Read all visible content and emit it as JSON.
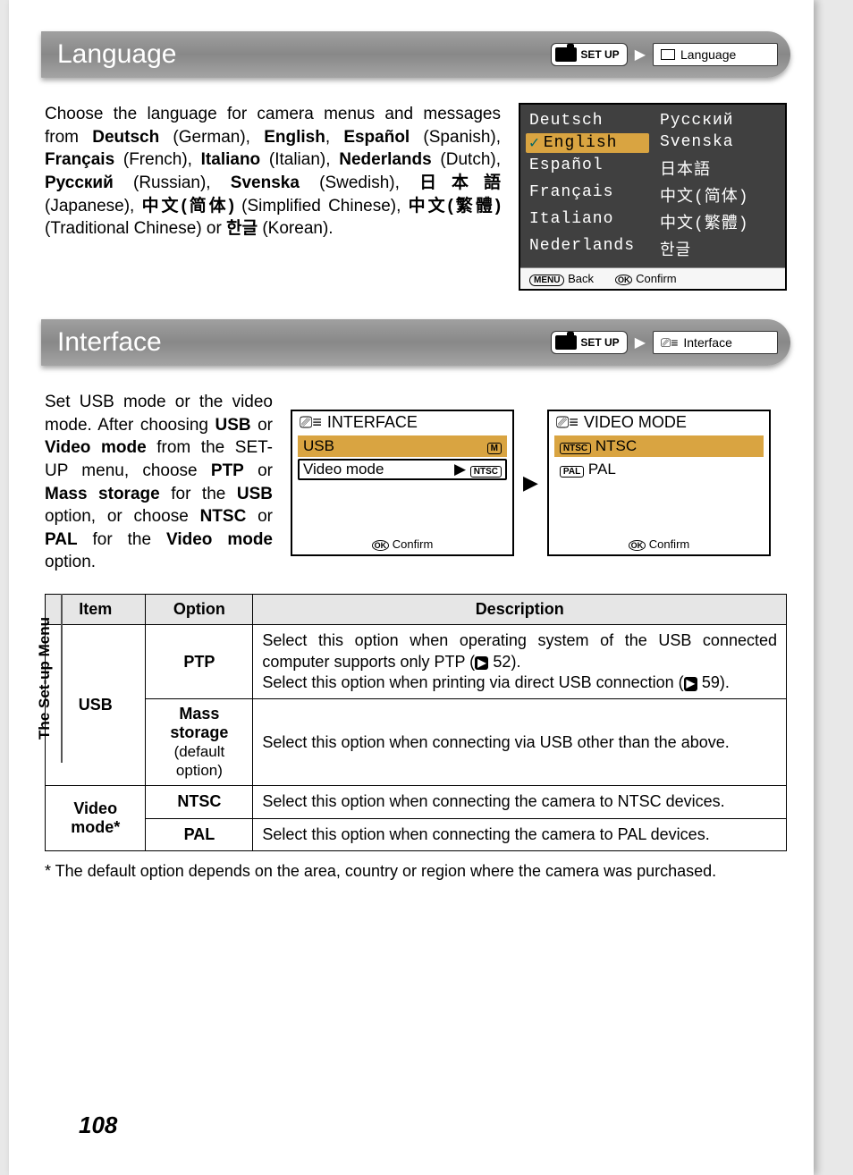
{
  "page_number": "108",
  "side_tab": "The Set-up Menu",
  "sections": {
    "language": {
      "title": "Language",
      "nav_setup": "SET UP",
      "nav_dest": "Language",
      "prose_html": "Choose the language for camera menus and messages from <b>Deutsch</b> (German), <b>English</b>, <b>Español</b> (Spanish), <b>Français</b> (French), <b>Italiano</b> (Italian), <b>Nederlands</b> (Dutch), <b>Русский</b> (Russian), <b>Svenska</b> (Swedish), <b>日本語</b> (Japanese), <b>中文(简体)</b> (Simplified Chinese), <b>中文(繁體)</b> (Traditional Chinese) or <b>한글</b> (Korean).",
      "menu": {
        "left": [
          "Deutsch",
          "English",
          "Español",
          "Français",
          "Italiano",
          "Nederlands"
        ],
        "right": [
          "Русский",
          "Svenska",
          "日本語",
          "中文(简体)",
          "中文(繁體)",
          "한글"
        ],
        "selected": "English",
        "footer_back_btn": "MENU",
        "footer_back": "Back",
        "footer_ok_btn": "OK",
        "footer_confirm": "Confirm"
      }
    },
    "interface": {
      "title": "Interface",
      "nav_setup": "SET UP",
      "nav_dest": "Interface",
      "prose_html": "Set USB mode or the video mode. After choosing <b>USB</b> or <b>Video mode</b> from the SET-UP menu, choose <b>PTP</b> or <b>Mass storage</b> for the <b>USB</b> option, or choose <b>NTSC</b> or <b>PAL</b> for the <b>Video mode</b> option.",
      "shot_interface": {
        "heading": "INTERFACE",
        "rows": [
          {
            "label": "USB",
            "badge": "M",
            "selected": true
          },
          {
            "label": "Video mode",
            "badge": "NTSC",
            "highlight": true
          }
        ],
        "footer_ok": "OK",
        "footer_confirm": "Confirm"
      },
      "shot_video": {
        "heading": "VIDEO MODE",
        "rows": [
          {
            "icon": "NTSC",
            "label": "NTSC",
            "selected": true
          },
          {
            "icon": "PAL",
            "label": "PAL"
          }
        ],
        "footer_ok": "OK",
        "footer_confirm": "Confirm"
      }
    }
  },
  "table": {
    "headers": [
      "Item",
      "Option",
      "Description"
    ],
    "rows": [
      {
        "item": "USB",
        "options": [
          {
            "name": "PTP",
            "sub": "",
            "desc": "Select this option when operating system of the USB connected computer supports only PTP (",
            "ref1": "52",
            "desc2": ").<br>Select this option when printing via direct USB connection (",
            "ref2": "59",
            "desc3": ")."
          },
          {
            "name": "Mass storage",
            "sub": "(default option)",
            "desc": "Select this option when connecting via USB other than the above."
          }
        ]
      },
      {
        "item": "Video mode*",
        "options": [
          {
            "name": "NTSC",
            "desc": "Select this option when connecting the camera to NTSC devices."
          },
          {
            "name": "PAL",
            "desc": "Select this option when connecting the camera to PAL devices."
          }
        ]
      }
    ]
  },
  "footnote": "* The default option depends on the area, country or region where the camera was purchased."
}
